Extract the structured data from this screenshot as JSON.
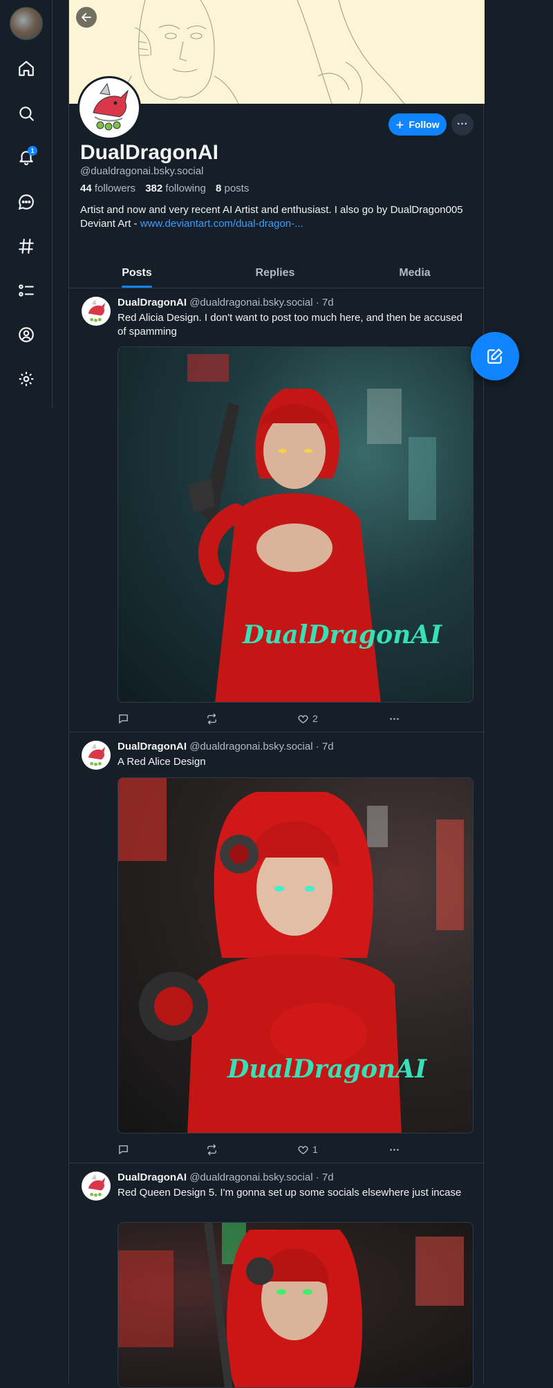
{
  "nav": {
    "notifications_badge": "1",
    "items": [
      "home",
      "search",
      "notifications",
      "chat",
      "feeds",
      "lists",
      "profile",
      "settings"
    ]
  },
  "profile": {
    "display_name": "DualDragonAI",
    "handle": "@dualdragonai.bsky.social",
    "followers_count": "44",
    "followers_label": "followers",
    "following_count": "382",
    "following_label": "following",
    "posts_count": "8",
    "posts_label": "posts",
    "bio_line1": "Artist and now and very recent AI Artist and enthusiast. I also go by DualDragon005",
    "bio_prefix": "Deviant Art - ",
    "bio_link": "www.deviantart.com/dual-dragon-...",
    "follow_label": "Follow",
    "more_label": "···"
  },
  "tabs": [
    {
      "label": "Posts",
      "active": true
    },
    {
      "label": "Replies",
      "active": false
    },
    {
      "label": "Media",
      "active": false
    }
  ],
  "posts": [
    {
      "author": "DualDragonAI",
      "handle": "@dualdragonai.bsky.social",
      "time": "· 7d",
      "text": "Red Alicia Design. I don't want to post too much here, and then be accused of spamming",
      "watermark": "DualDragonAI",
      "likes": "2"
    },
    {
      "author": "DualDragonAI",
      "handle": "@dualdragonai.bsky.social",
      "time": "· 7d",
      "text": "A Red Alice Design",
      "watermark": "DualDragonAI",
      "likes": "1"
    },
    {
      "author": "DualDragonAI",
      "handle": "@dualdragonai.bsky.social",
      "time": "· 7d",
      "text": "Red Queen Design 5. I'm gonna set up some socials elsewhere just incase",
      "watermark": "",
      "likes": ""
    }
  ],
  "colors": {
    "background": "#161e27",
    "accent": "#1083fe",
    "muted_text": "#aebbc9",
    "border": "#2e3a47",
    "banner": "#fbf5d6"
  }
}
